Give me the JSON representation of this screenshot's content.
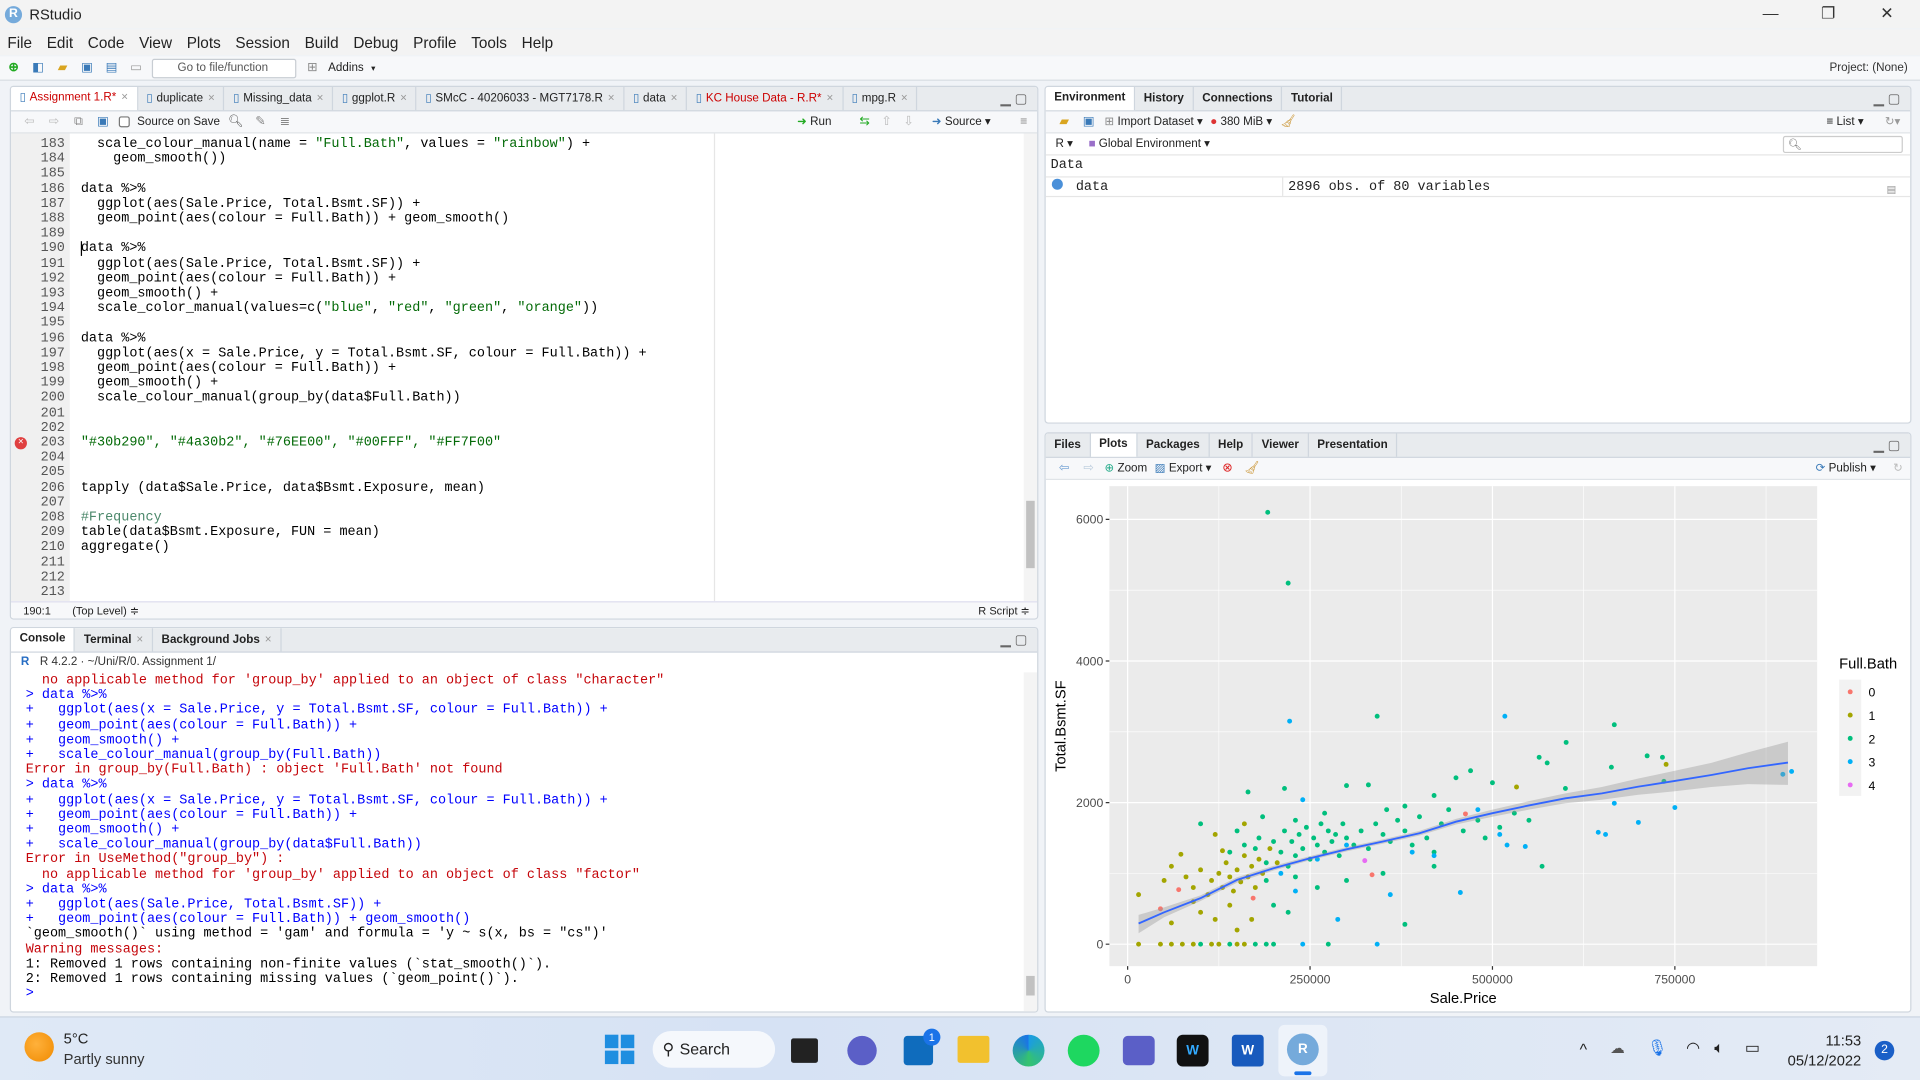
{
  "window": {
    "title": "RStudio",
    "controls": [
      "—",
      "❐",
      "✕"
    ]
  },
  "menu": [
    "File",
    "Edit",
    "Code",
    "View",
    "Plots",
    "Session",
    "Build",
    "Debug",
    "Profile",
    "Tools",
    "Help"
  ],
  "toolbar": {
    "goto_placeholder": "Go to file/function",
    "addins": "Addins",
    "project": "Project: (None)"
  },
  "source": {
    "tabs": [
      {
        "label": "Assignment 1.R*",
        "modified": true,
        "active": true
      },
      {
        "label": "duplicate"
      },
      {
        "label": "Missing_data"
      },
      {
        "label": "ggplot.R"
      },
      {
        "label": "SMcC - 40206033 - MGT7178.R"
      },
      {
        "label": "data"
      },
      {
        "label": "KC House Data - R.R*",
        "modified": true
      },
      {
        "label": "mpg.R"
      }
    ],
    "source_on_save": "Source on Save",
    "run": "Run",
    "source_btn": "Source",
    "lines": [
      {
        "n": "183",
        "t": "  scale_colour_manual(name = \"Full.Bath\", values = \"rainbow\") +"
      },
      {
        "n": "184",
        "t": "    geom_smooth())"
      },
      {
        "n": "185",
        "t": ""
      },
      {
        "n": "186",
        "t": "data %>%"
      },
      {
        "n": "187",
        "t": "  ggplot(aes(Sale.Price, Total.Bsmt.SF)) +"
      },
      {
        "n": "188",
        "t": "  geom_point(aes(colour = Full.Bath)) + geom_smooth()"
      },
      {
        "n": "189",
        "t": ""
      },
      {
        "n": "190",
        "t": "data %>%"
      },
      {
        "n": "191",
        "t": "  ggplot(aes(Sale.Price, Total.Bsmt.SF)) +"
      },
      {
        "n": "192",
        "t": "  geom_point(aes(colour = Full.Bath)) +"
      },
      {
        "n": "193",
        "t": "  geom_smooth() +"
      },
      {
        "n": "194",
        "t": "  scale_color_manual(values=c(\"blue\", \"red\", \"green\", \"orange\"))"
      },
      {
        "n": "195",
        "t": ""
      },
      {
        "n": "196",
        "t": "data %>%"
      },
      {
        "n": "197",
        "t": "  ggplot(aes(x = Sale.Price, y = Total.Bsmt.SF, colour = Full.Bath)) +"
      },
      {
        "n": "198",
        "t": "  geom_point(aes(colour = Full.Bath)) +"
      },
      {
        "n": "199",
        "t": "  geom_smooth() +"
      },
      {
        "n": "200",
        "t": "  scale_colour_manual(group_by(data$Full.Bath))"
      },
      {
        "n": "201",
        "t": ""
      },
      {
        "n": "202",
        "t": ""
      },
      {
        "n": "203",
        "t": "\"#30b290\", \"#4a30b2\", \"#76EE00\", \"#00FFF\", \"#FF7F00\"",
        "error": true
      },
      {
        "n": "204",
        "t": ""
      },
      {
        "n": "205",
        "t": ""
      },
      {
        "n": "206",
        "t": "tapply (data$Sale.Price, data$Bsmt.Exposure, mean)"
      },
      {
        "n": "207",
        "t": ""
      },
      {
        "n": "208",
        "t": "#Frequency"
      },
      {
        "n": "209",
        "t": "table(data$Bsmt.Exposure, FUN = mean)"
      },
      {
        "n": "210",
        "t": "aggregate()"
      },
      {
        "n": "211",
        "t": ""
      },
      {
        "n": "212",
        "t": ""
      },
      {
        "n": "213",
        "t": ""
      }
    ],
    "status": {
      "position": "190:1",
      "scope": "(Top Level) ≑",
      "filetype": "R Script ≑"
    }
  },
  "console": {
    "tabs": [
      {
        "label": "Console",
        "active": true
      },
      {
        "label": "Terminal"
      },
      {
        "label": "Background Jobs"
      }
    ],
    "path": "R 4.2.2 · ~/Uni/R/0. Assignment 1/",
    "lines": [
      {
        "t": "  no applicable method for 'group_by' applied to an object of class \"character\"",
        "k": "err"
      },
      {
        "t": "> data %>%",
        "k": "inp"
      },
      {
        "t": "+   ggplot(aes(x = Sale.Price, y = Total.Bsmt.SF, colour = Full.Bath)) +",
        "k": "inp"
      },
      {
        "t": "+   geom_point(aes(colour = Full.Bath)) +",
        "k": "inp"
      },
      {
        "t": "+   geom_smooth() +",
        "k": "inp"
      },
      {
        "t": "+   scale_colour_manual(group_by(Full.Bath))",
        "k": "inp"
      },
      {
        "t": "Error in group_by(Full.Bath) : object 'Full.Bath' not found",
        "k": "err"
      },
      {
        "t": "> data %>%",
        "k": "inp"
      },
      {
        "t": "+   ggplot(aes(x = Sale.Price, y = Total.Bsmt.SF, colour = Full.Bath)) +",
        "k": "inp"
      },
      {
        "t": "+   geom_point(aes(colour = Full.Bath)) +",
        "k": "inp"
      },
      {
        "t": "+   geom_smooth() +",
        "k": "inp"
      },
      {
        "t": "+   scale_colour_manual(group_by(data$Full.Bath))",
        "k": "inp"
      },
      {
        "t": "Error in UseMethod(\"group_by\") :",
        "k": "err"
      },
      {
        "t": "  no applicable method for 'group_by' applied to an object of class \"factor\"",
        "k": "err"
      },
      {
        "t": "> data %>%",
        "k": "inp"
      },
      {
        "t": "+   ggplot(aes(Sale.Price, Total.Bsmt.SF)) +",
        "k": "inp"
      },
      {
        "t": "+   geom_point(aes(colour = Full.Bath)) + geom_smooth()",
        "k": "inp"
      },
      {
        "t": "`geom_smooth()` using method = 'gam' and formula = 'y ~ s(x, bs = \"cs\")'",
        "k": "out"
      },
      {
        "t": "Warning messages:",
        "k": "err"
      },
      {
        "t": "1: Removed 1 rows containing non-finite values (`stat_smooth()`).",
        "k": "out"
      },
      {
        "t": "2: Removed 1 rows containing missing values (`geom_point()`).",
        "k": "out"
      },
      {
        "t": "> ",
        "k": "inp"
      }
    ]
  },
  "environment": {
    "tabs": [
      {
        "label": "Environment",
        "active": true
      },
      {
        "label": "History"
      },
      {
        "label": "Connections"
      },
      {
        "label": "Tutorial"
      }
    ],
    "import_dataset": "Import Dataset",
    "memory": "380 MiB",
    "list_view": "List",
    "language": "R",
    "scope": "Global Environment",
    "section": "Data",
    "rows": [
      {
        "name": "data",
        "value": "2896 obs. of 80 variables"
      }
    ]
  },
  "files": {
    "tabs": [
      {
        "label": "Files"
      },
      {
        "label": "Plots",
        "active": true
      },
      {
        "label": "Packages"
      },
      {
        "label": "Help"
      },
      {
        "label": "Viewer"
      },
      {
        "label": "Presentation"
      }
    ],
    "zoom": "Zoom",
    "export": "Export",
    "publish": "Publish"
  },
  "chart_data": {
    "type": "scatter",
    "xlabel": "Sale.Price",
    "ylabel": "Total.Bsmt.SF",
    "xlim": [
      -25000,
      945000
    ],
    "ylim": [
      -310,
      6470
    ],
    "xticks": [
      0,
      250000,
      500000,
      750000
    ],
    "yticks": [
      0,
      2000,
      4000,
      6000
    ],
    "grid": true,
    "legend_position": "right",
    "legend_title": "Full.Bath",
    "legend": [
      {
        "label": "0",
        "color": "#F8766D"
      },
      {
        "label": "1",
        "color": "#A3A500"
      },
      {
        "label": "2",
        "color": "#00BF7D"
      },
      {
        "label": "3",
        "color": "#00B0F6"
      },
      {
        "label": "4",
        "color": "#E76BF3"
      }
    ],
    "smooth": {
      "color": "#3366FF",
      "x": [
        15000,
        50000,
        100000,
        150000,
        200000,
        250000,
        300000,
        350000,
        400000,
        450000,
        500000,
        550000,
        600000,
        650000,
        700000,
        750000,
        800000,
        850000,
        905000
      ],
      "y": [
        292,
        450,
        650,
        908,
        1073,
        1214,
        1340,
        1450,
        1567,
        1730,
        1850,
        1960,
        2060,
        2130,
        2225,
        2306,
        2390,
        2485,
        2565
      ],
      "lower": [
        155,
        380,
        610,
        870,
        1040,
        1185,
        1310,
        1420,
        1535,
        1690,
        1800,
        1900,
        1990,
        2040,
        2110,
        2160,
        2220,
        2260,
        2250
      ],
      "upper": [
        414,
        520,
        690,
        946,
        1106,
        1243,
        1370,
        1480,
        1600,
        1770,
        1900,
        2020,
        2130,
        2220,
        2340,
        2450,
        2560,
        2710,
        2860
      ]
    },
    "points": [
      [
        192000,
        6100,
        2
      ],
      [
        220000,
        5100,
        2
      ],
      [
        222000,
        3150,
        3
      ],
      [
        342000,
        3220,
        2
      ],
      [
        517000,
        3220,
        3
      ],
      [
        667000,
        3100,
        2
      ],
      [
        601000,
        2850,
        2
      ],
      [
        712000,
        2660,
        2
      ],
      [
        733000,
        2640,
        2
      ],
      [
        738000,
        2540,
        1
      ],
      [
        564000,
        2640,
        2
      ],
      [
        575000,
        2560,
        2
      ],
      [
        663000,
        2500,
        2
      ],
      [
        898000,
        2400,
        3
      ],
      [
        910000,
        2440,
        3
      ],
      [
        735000,
        2300,
        2
      ],
      [
        533000,
        2220,
        1
      ],
      [
        600000,
        2200,
        2
      ],
      [
        750000,
        1930,
        3
      ],
      [
        667000,
        1990,
        3
      ],
      [
        700000,
        1720,
        3
      ],
      [
        645000,
        1580,
        3
      ],
      [
        655000,
        1550,
        3
      ],
      [
        568000,
        1100,
        2
      ],
      [
        456000,
        730,
        3
      ],
      [
        380000,
        280,
        2
      ],
      [
        288000,
        350,
        3
      ],
      [
        463000,
        1840,
        0
      ],
      [
        335000,
        980,
        0
      ],
      [
        45000,
        500,
        0
      ],
      [
        172000,
        650,
        0
      ],
      [
        70000,
        770,
        0
      ],
      [
        325000,
        1180,
        4
      ],
      [
        15000,
        700,
        1
      ],
      [
        15000,
        0,
        1
      ],
      [
        45000,
        0,
        1
      ],
      [
        60000,
        0,
        1
      ],
      [
        75000,
        0,
        1
      ],
      [
        90000,
        0,
        1
      ],
      [
        100000,
        0,
        2
      ],
      [
        115000,
        0,
        1
      ],
      [
        125000,
        0,
        1
      ],
      [
        140000,
        0,
        2
      ],
      [
        150000,
        0,
        1
      ],
      [
        160000,
        0,
        1
      ],
      [
        175000,
        0,
        2
      ],
      [
        190000,
        0,
        2
      ],
      [
        200000,
        0,
        2
      ],
      [
        240000,
        0,
        3
      ],
      [
        275000,
        0,
        2
      ],
      [
        342000,
        0,
        3
      ],
      [
        130000,
        1320,
        1
      ],
      [
        73000,
        1270,
        1
      ],
      [
        100000,
        1700,
        2
      ],
      [
        165000,
        2150,
        2
      ],
      [
        215000,
        2200,
        2
      ],
      [
        240000,
        2040,
        3
      ],
      [
        300000,
        2240,
        2
      ],
      [
        330000,
        2250,
        2
      ],
      [
        450000,
        2350,
        2
      ],
      [
        470000,
        2450,
        2
      ],
      [
        500000,
        2280,
        2
      ],
      [
        420000,
        2100,
        2
      ],
      [
        380000,
        1950,
        2
      ],
      [
        355000,
        1900,
        2
      ],
      [
        270000,
        1850,
        2
      ],
      [
        230000,
        1750,
        2
      ],
      [
        185000,
        1800,
        2
      ],
      [
        160000,
        1700,
        1
      ],
      [
        150000,
        1600,
        2
      ],
      [
        120000,
        1550,
        1
      ],
      [
        50000,
        900,
        1
      ],
      [
        60000,
        1100,
        1
      ],
      [
        80000,
        950,
        1
      ],
      [
        90000,
        800,
        1
      ],
      [
        100000,
        1050,
        1
      ],
      [
        110000,
        700,
        1
      ],
      [
        115000,
        900,
        1
      ],
      [
        125000,
        1000,
        1
      ],
      [
        130000,
        800,
        1
      ],
      [
        135000,
        1150,
        1
      ],
      [
        140000,
        950,
        1
      ],
      [
        145000,
        750,
        1
      ],
      [
        150000,
        1050,
        1
      ],
      [
        155000,
        880,
        1
      ],
      [
        160000,
        1250,
        1
      ],
      [
        165000,
        950,
        1
      ],
      [
        170000,
        1100,
        1
      ],
      [
        175000,
        800,
        1
      ],
      [
        180000,
        1200,
        1
      ],
      [
        185000,
        1000,
        1
      ],
      [
        195000,
        1350,
        1
      ],
      [
        205000,
        1150,
        1
      ],
      [
        90000,
        600,
        1
      ],
      [
        100000,
        450,
        1
      ],
      [
        120000,
        350,
        1
      ],
      [
        140000,
        550,
        1
      ],
      [
        60000,
        300,
        1
      ],
      [
        150000,
        200,
        1
      ],
      [
        170000,
        350,
        1
      ],
      [
        140000,
        1300,
        2
      ],
      [
        160000,
        1400,
        2
      ],
      [
        175000,
        1350,
        2
      ],
      [
        180000,
        1500,
        2
      ],
      [
        190000,
        1150,
        2
      ],
      [
        200000,
        1450,
        2
      ],
      [
        210000,
        1300,
        2
      ],
      [
        215000,
        1600,
        2
      ],
      [
        220000,
        1100,
        2
      ],
      [
        225000,
        1450,
        2
      ],
      [
        230000,
        1250,
        2
      ],
      [
        235000,
        1550,
        2
      ],
      [
        240000,
        1350,
        2
      ],
      [
        245000,
        1650,
        2
      ],
      [
        250000,
        1200,
        2
      ],
      [
        255000,
        1500,
        2
      ],
      [
        260000,
        1400,
        2
      ],
      [
        265000,
        1700,
        2
      ],
      [
        270000,
        1300,
        2
      ],
      [
        275000,
        1600,
        2
      ],
      [
        280000,
        1450,
        2
      ],
      [
        285000,
        1550,
        2
      ],
      [
        290000,
        1250,
        2
      ],
      [
        295000,
        1700,
        2
      ],
      [
        300000,
        1500,
        2
      ],
      [
        310000,
        1400,
        2
      ],
      [
        320000,
        1600,
        2
      ],
      [
        330000,
        1350,
        2
      ],
      [
        340000,
        1700,
        2
      ],
      [
        350000,
        1550,
        2
      ],
      [
        360000,
        1450,
        2
      ],
      [
        370000,
        1750,
        2
      ],
      [
        380000,
        1600,
        2
      ],
      [
        390000,
        1400,
        2
      ],
      [
        400000,
        1800,
        2
      ],
      [
        410000,
        1500,
        2
      ],
      [
        420000,
        1300,
        2
      ],
      [
        430000,
        1700,
        2
      ],
      [
        440000,
        1900,
        2
      ],
      [
        460000,
        1600,
        2
      ],
      [
        480000,
        1750,
        2
      ],
      [
        490000,
        1500,
        2
      ],
      [
        510000,
        1650,
        2
      ],
      [
        530000,
        1850,
        2
      ],
      [
        550000,
        1750,
        2
      ],
      [
        200000,
        550,
        2
      ],
      [
        220000,
        450,
        2
      ],
      [
        260000,
        800,
        2
      ],
      [
        300000,
        900,
        2
      ],
      [
        350000,
        1000,
        2
      ],
      [
        420000,
        1100,
        2
      ],
      [
        190000,
        900,
        2
      ],
      [
        230000,
        950,
        2
      ],
      [
        210000,
        1000,
        3
      ],
      [
        230000,
        750,
        3
      ],
      [
        260000,
        1200,
        3
      ],
      [
        300000,
        1400,
        3
      ],
      [
        360000,
        700,
        3
      ],
      [
        390000,
        1300,
        3
      ],
      [
        420000,
        1250,
        3
      ],
      [
        480000,
        1900,
        3
      ],
      [
        520000,
        1400,
        3
      ],
      [
        545000,
        1380,
        3
      ],
      [
        510000,
        1550,
        3
      ]
    ]
  },
  "taskbar": {
    "weather_temp": "5°C",
    "weather_desc": "Partly sunny",
    "search": "Search",
    "time": "11:53",
    "date": "05/12/2022",
    "notifications": "2",
    "mail_badge": "1"
  }
}
